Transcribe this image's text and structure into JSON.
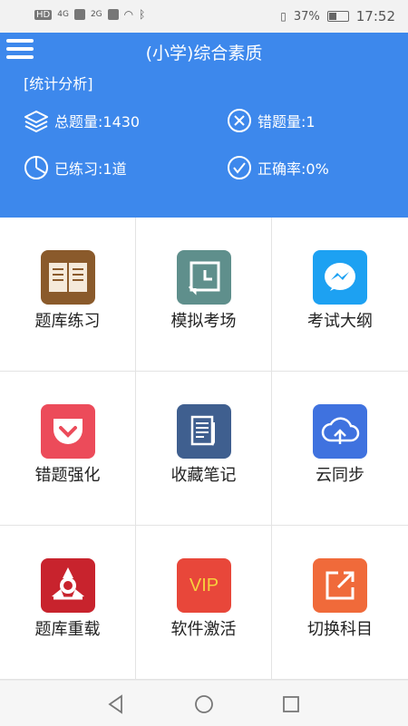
{
  "status_bar": {
    "left_indicators": "HD",
    "signal_1": "4G",
    "signal_2": "2G",
    "battery": "37%",
    "time": "17:52"
  },
  "header": {
    "title": "(小学)综合素质",
    "section_title": "[统计分析]",
    "stats": {
      "total": "总题量:1430",
      "wrong": "错题量:1",
      "practiced": "已练习:1道",
      "accuracy": "正确率:0%"
    }
  },
  "grid": {
    "items": [
      {
        "label": "题库练习",
        "icon": "book-icon",
        "color": "#8a5a2b"
      },
      {
        "label": "模拟考场",
        "icon": "clock-icon",
        "color": "#5f8f8c"
      },
      {
        "label": "考试大纲",
        "icon": "messenger-icon",
        "color": "#1da1f2"
      },
      {
        "label": "错题强化",
        "icon": "pocket-icon",
        "color": "#ec4b5a"
      },
      {
        "label": "收藏笔记",
        "icon": "notes-icon",
        "color": "#3f5f8f"
      },
      {
        "label": "云同步",
        "icon": "cloud-upload-icon",
        "color": "#3f72df"
      },
      {
        "label": "题库重载",
        "icon": "reload-icon",
        "color": "#c8232d"
      },
      {
        "label": "软件激活",
        "icon": "vip-icon",
        "color": "#e8473a",
        "icon_text": "VIP"
      },
      {
        "label": "切换科目",
        "icon": "switch-icon",
        "color": "#f06a3a"
      }
    ]
  },
  "nav_bar": {
    "back": "back-icon",
    "home": "home-icon",
    "recent": "recent-apps-icon"
  }
}
